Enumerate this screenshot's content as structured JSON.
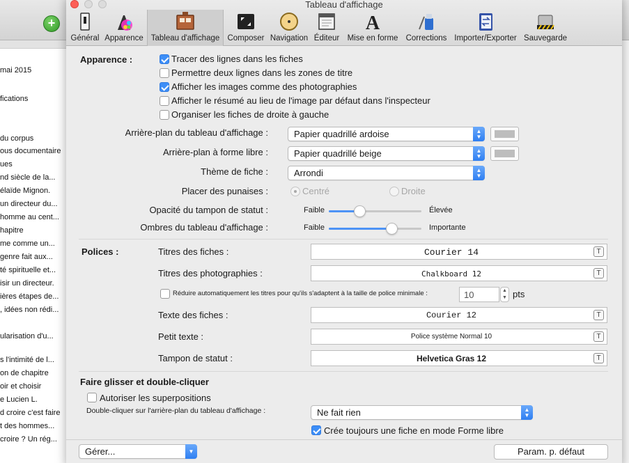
{
  "window": {
    "title": "Tableau d'affichage"
  },
  "background_list": [
    "mai 2015",
    "fications",
    "du corpus",
    "ous documentaire",
    "ues",
    "nd siècle de la...",
    "élaïde Mignon.",
    "un directeur du...",
    "homme au cent...",
    "hapitre",
    "me comme un...",
    "genre fait aux...",
    "té spirituelle et...",
    "isir un directeur.",
    "ières étapes de...",
    ", idées non rédi...",
    "ularisation d'u...",
    "s l'intimité de l...",
    "on de chapitre",
    "oir et choisir",
    "e Lucien L.",
    "d croire c'est faire",
    "t des hommes...",
    "croire ? Un rég..."
  ],
  "toolbar": {
    "items": [
      {
        "label": "Général",
        "icon": "switch-icon"
      },
      {
        "label": "Apparence",
        "icon": "palette-icon"
      },
      {
        "label": "Tableau d'affichage",
        "icon": "corkboard-icon"
      },
      {
        "label": "Composer",
        "icon": "fullscreen-icon"
      },
      {
        "label": "Navigation",
        "icon": "compass-icon"
      },
      {
        "label": "Éditeur",
        "icon": "editor-window-icon"
      },
      {
        "label": "Mise en forme",
        "icon": "letter-a-icon"
      },
      {
        "label": "Corrections",
        "icon": "correction-icon"
      },
      {
        "label": "Importer/Exporter",
        "icon": "notebook-arrows-icon"
      },
      {
        "label": "Sauvegarde",
        "icon": "backup-drive-icon"
      }
    ],
    "selected_index": 2
  },
  "apparence": {
    "title": "Apparence :",
    "checkboxes": [
      {
        "label": "Tracer des lignes dans les fiches",
        "checked": true
      },
      {
        "label": "Permettre deux lignes dans les zones de titre",
        "checked": false
      },
      {
        "label": "Afficher les images comme des photographies",
        "checked": true
      },
      {
        "label": "Afficher le résumé au lieu de l'image par défaut dans l'inspecteur",
        "checked": false
      },
      {
        "label": "Organiser les fiches de droite à gauche",
        "checked": false
      }
    ],
    "background_label": "Arrière-plan du tableau d'affichage :",
    "background_value": "Papier quadrillé ardoise",
    "freeform_label": "Arrière-plan à forme libre :",
    "freeform_value": "Papier quadrillé beige",
    "theme_label": "Thème de fiche :",
    "theme_value": "Arrondi",
    "pins_label": "Placer des punaises :",
    "pins_options": [
      "Centré",
      "Droite"
    ],
    "pins_selected": "Centré",
    "opacity_label": "Opacité du tampon de statut :",
    "opacity_min": "Faible",
    "opacity_max": "Élevée",
    "opacity_value": 0.33,
    "shadow_label": "Ombres du tableau d'affichage :",
    "shadow_min": "Faible",
    "shadow_max": "Importante",
    "shadow_value": 0.68
  },
  "polices": {
    "title": "Polices :",
    "card_titles_label": "Titres des fiches :",
    "card_titles_value": "Courier 14",
    "photo_titles_label": "Titres des photographies :",
    "photo_titles_value": "Chalkboard 12",
    "shrink_label": "Réduire automatiquement les titres pour qu'ils s'adaptent à la taille de police minimale :",
    "shrink_checked": false,
    "shrink_value": "10",
    "shrink_unit": "pts",
    "card_text_label": "Texte des fiches :",
    "card_text_value": "Courier 12",
    "small_text_label": "Petit texte :",
    "small_text_value": "Police système Normal 10",
    "stamp_label": "Tampon de statut :",
    "stamp_value": "Helvetica Gras 12",
    "font_button_glyph": "T"
  },
  "drag": {
    "title": "Faire glisser et double-cliquer",
    "overlap_label": "Autoriser les superpositions",
    "overlap_checked": false,
    "doubleclick_label": "Double-cliquer sur l'arrière-plan du tableau d'affichage :",
    "doubleclick_value": "Ne fait rien",
    "freeform_label": "Crée toujours une fiche en mode Forme libre",
    "freeform_checked": true
  },
  "footer": {
    "manage_label": "Gérer...",
    "defaults_label": "Param. p. défaut"
  }
}
